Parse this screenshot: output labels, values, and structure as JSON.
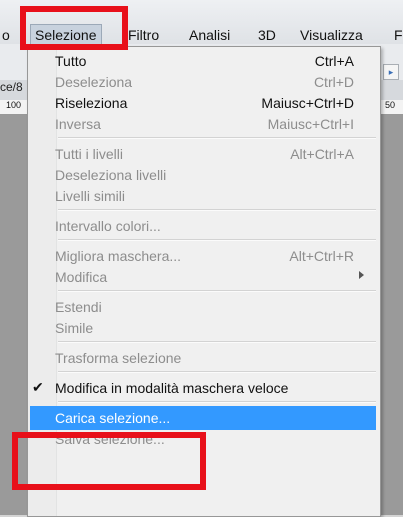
{
  "menubar": {
    "items": [
      "o",
      "Selezione",
      "Filtro",
      "Analisi",
      "3D",
      "Visualizza",
      "F"
    ],
    "active": "Selezione"
  },
  "background": {
    "tab_fragment": "ce/8",
    "ruler_left": "100",
    "ruler_right": "50"
  },
  "dropdown": {
    "groups": [
      [
        {
          "label": "Tutto",
          "shortcut": "Ctrl+A",
          "enabled": true
        },
        {
          "label": "Deseleziona",
          "shortcut": "Ctrl+D",
          "enabled": false
        },
        {
          "label": "Riseleziona",
          "shortcut": "Maiusc+Ctrl+D",
          "enabled": true
        },
        {
          "label": "Inversa",
          "shortcut": "Maiusc+Ctrl+I",
          "enabled": false
        }
      ],
      [
        {
          "label": "Tutti i livelli",
          "shortcut": "Alt+Ctrl+A",
          "enabled": false
        },
        {
          "label": "Deseleziona livelli",
          "shortcut": "",
          "enabled": false
        },
        {
          "label": "Livelli simili",
          "shortcut": "",
          "enabled": false
        }
      ],
      [
        {
          "label": "Intervallo colori...",
          "shortcut": "",
          "enabled": false
        }
      ],
      [
        {
          "label": "Migliora maschera...",
          "shortcut": "Alt+Ctrl+R",
          "enabled": false
        },
        {
          "label": "Modifica",
          "shortcut": "",
          "enabled": false,
          "submenu": true
        }
      ],
      [
        {
          "label": "Estendi",
          "shortcut": "",
          "enabled": false
        },
        {
          "label": "Simile",
          "shortcut": "",
          "enabled": false
        }
      ],
      [
        {
          "label": "Trasforma selezione",
          "shortcut": "",
          "enabled": false
        }
      ],
      [
        {
          "label": "Modifica in modalità maschera veloce",
          "shortcut": "",
          "enabled": true,
          "checked": true
        }
      ],
      [
        {
          "label": "Carica selezione...",
          "shortcut": "",
          "enabled": true,
          "highlighted": true
        },
        {
          "label": "Salva selezione...",
          "shortcut": "",
          "enabled": false
        }
      ]
    ]
  },
  "colors": {
    "highlight": "#3399ff",
    "annotation_red": "#e8101a",
    "disabled_text": "#8d8d8d"
  }
}
